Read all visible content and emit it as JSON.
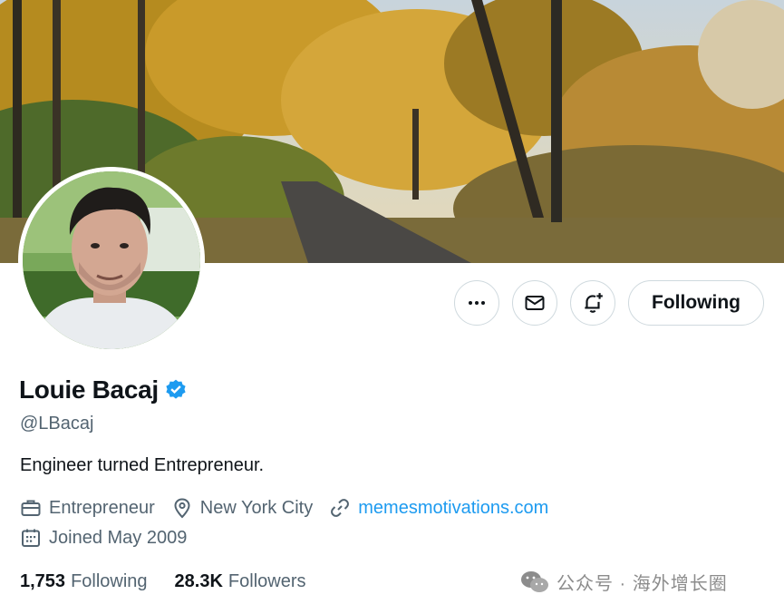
{
  "profile": {
    "name": "Louie Bacaj",
    "handle": "@LBacaj",
    "bio": "Engineer turned Entrepreneur.",
    "category": "Entrepreneur",
    "location": "New York City",
    "website": "memesmotivations.com",
    "joined": "Joined May 2009",
    "verified": true
  },
  "actions": {
    "more_icon": "more-horizontal-icon",
    "message_icon": "envelope-icon",
    "notify_icon": "bell-plus-icon",
    "follow_label": "Following"
  },
  "stats": {
    "following_count": "1,753",
    "following_label": "Following",
    "followers_count": "28.3K",
    "followers_label": "Followers"
  },
  "watermark": {
    "text": "公众号 · 海外增长圈"
  },
  "colors": {
    "link": "#1d9bf0",
    "verified": "#1d9bf0",
    "secondary_text": "#536471",
    "border": "#cfd9de"
  }
}
